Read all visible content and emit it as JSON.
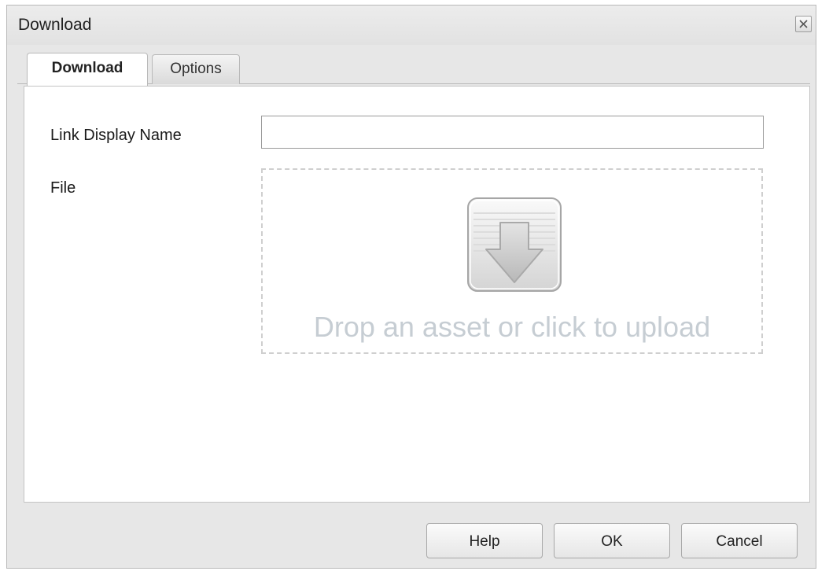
{
  "window": {
    "title": "Download",
    "close_icon": "close-icon"
  },
  "tabs": [
    {
      "label": "Download",
      "active": true
    },
    {
      "label": "Options",
      "active": false
    }
  ],
  "form": {
    "link_display_name": {
      "label": "Link Display Name",
      "value": "",
      "placeholder": ""
    },
    "file": {
      "label": "File",
      "dropzone_icon": "download-arrow-icon",
      "dropzone_text": "Drop an asset or click to upload"
    }
  },
  "footer": {
    "help_label": "Help",
    "ok_label": "OK",
    "cancel_label": "Cancel"
  },
  "colors": {
    "dropzone_text": "#c6cdd3",
    "dialog_background": "#e7e7e7"
  }
}
